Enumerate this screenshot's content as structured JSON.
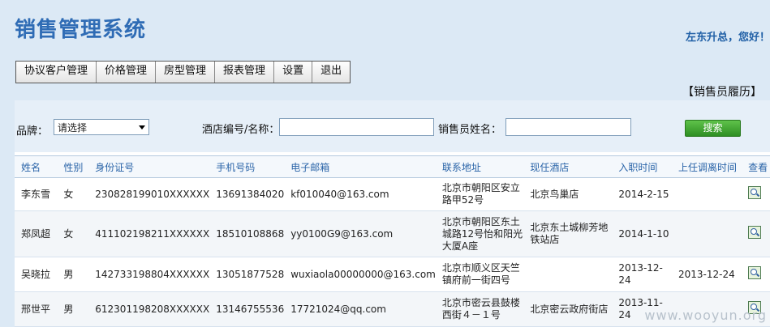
{
  "app": {
    "title": "销售管理系统",
    "greeting": "左东升总，您好！"
  },
  "menu": [
    "协议客户管理",
    "价格管理",
    "房型管理",
    "报表管理",
    "设置",
    "退出"
  ],
  "history_link": "【销售员履历】",
  "search": {
    "brand_label": "品牌：",
    "brand_value": "请选择",
    "hotel_label": "酒店编号/名称：",
    "hotel_value": "",
    "sales_label": "销售员姓名：",
    "sales_value": "",
    "button": "搜索"
  },
  "table": {
    "headers": [
      "姓名",
      "性别",
      "身份证号",
      "手机号码",
      "电子邮箱",
      "联系地址",
      "现任酒店",
      "入职时间",
      "上任调离时间",
      "查看"
    ],
    "rows": [
      [
        "李东雪",
        "女",
        "230828199010XXXXXX",
        "13691384020",
        "kf010040@163.com",
        "北京市朝阳区安立路甲52号",
        "北京鸟巢店",
        "2014-2-15",
        ""
      ],
      [
        "郑凤超",
        "女",
        "411102198211XXXXXX",
        "18510108868",
        "yy0100G9@163.com",
        "北京市朝阳区东土城路12号怡和阳光大厦A座",
        "北京东土城柳芳地铁站店",
        "2014-1-10",
        ""
      ],
      [
        "吴晓拉",
        "男",
        "142733198804XXXXXX",
        "13051877528",
        "wuxiaola00000000@163.com",
        "北京市顺义区天竺镇府前一街四号",
        "",
        "2013-12-24",
        "2013-12-24"
      ],
      [
        "邢世平",
        "男",
        "612301198208XXXXXX",
        "13146755536",
        "17721024@qq.com",
        "北京市密云县鼓楼西街４－１号",
        "北京密云政府街店",
        "2013-11-24",
        ""
      ]
    ]
  },
  "watermark": "www.wooyun.org",
  "colors": {
    "title": "#2f6cb5",
    "header_text": "#2a64a8",
    "search_button": "#3a9e2c"
  }
}
